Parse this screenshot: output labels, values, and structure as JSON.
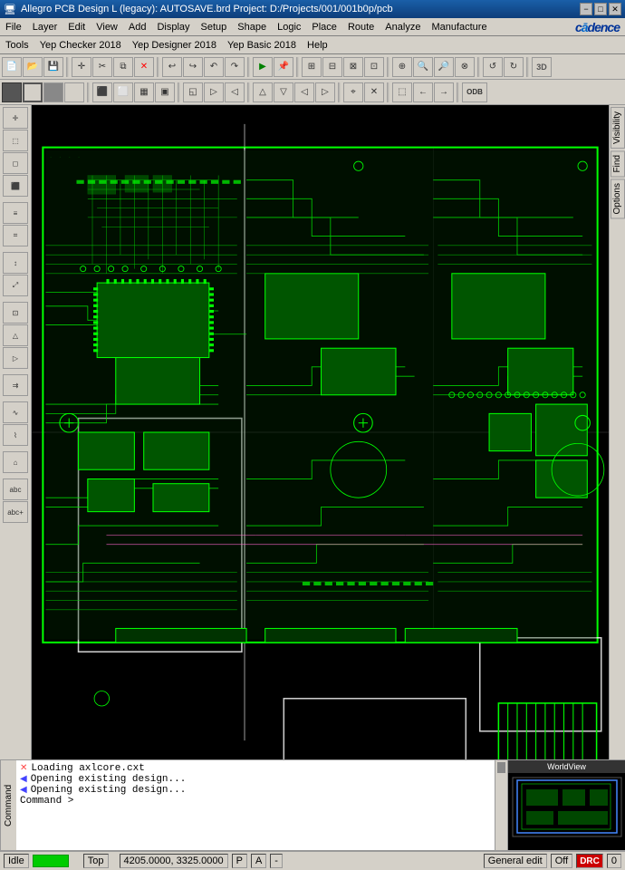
{
  "titleBar": {
    "title": "Allegro PCB Design L (legacy): AUTOSAVE.brd  Project: D:/Projects/001/001b0p/pcb",
    "minBtn": "−",
    "maxBtn": "□",
    "closeBtn": "✕"
  },
  "menuBar1": {
    "items": [
      "File",
      "Layer",
      "Edit",
      "View",
      "Add",
      "Display",
      "Setup",
      "Shape",
      "Logic",
      "Place",
      "Route",
      "Analyze",
      "Manufacture"
    ]
  },
  "menuBar2": {
    "items": [
      "Tools",
      "Yep Checker 2018",
      "Yep Designer 2018",
      "Yep Basic 2018",
      "Help"
    ]
  },
  "rightPanel": {
    "tabs": [
      "Visibility",
      "Find",
      "Options"
    ]
  },
  "commandArea": {
    "label": "Command",
    "lines": [
      "Loading axlcore.cxt",
      "Opening existing design...",
      "Opening existing design...",
      "Command >"
    ]
  },
  "minimapLabel": "WorldView",
  "statusBar": {
    "idle": "Idle",
    "layer": "Top",
    "coords": "4205.0000, 3325.0000",
    "p": "P",
    "a": "A",
    "dash": "-",
    "mode": "General edit",
    "off": "Off",
    "number": "0"
  }
}
